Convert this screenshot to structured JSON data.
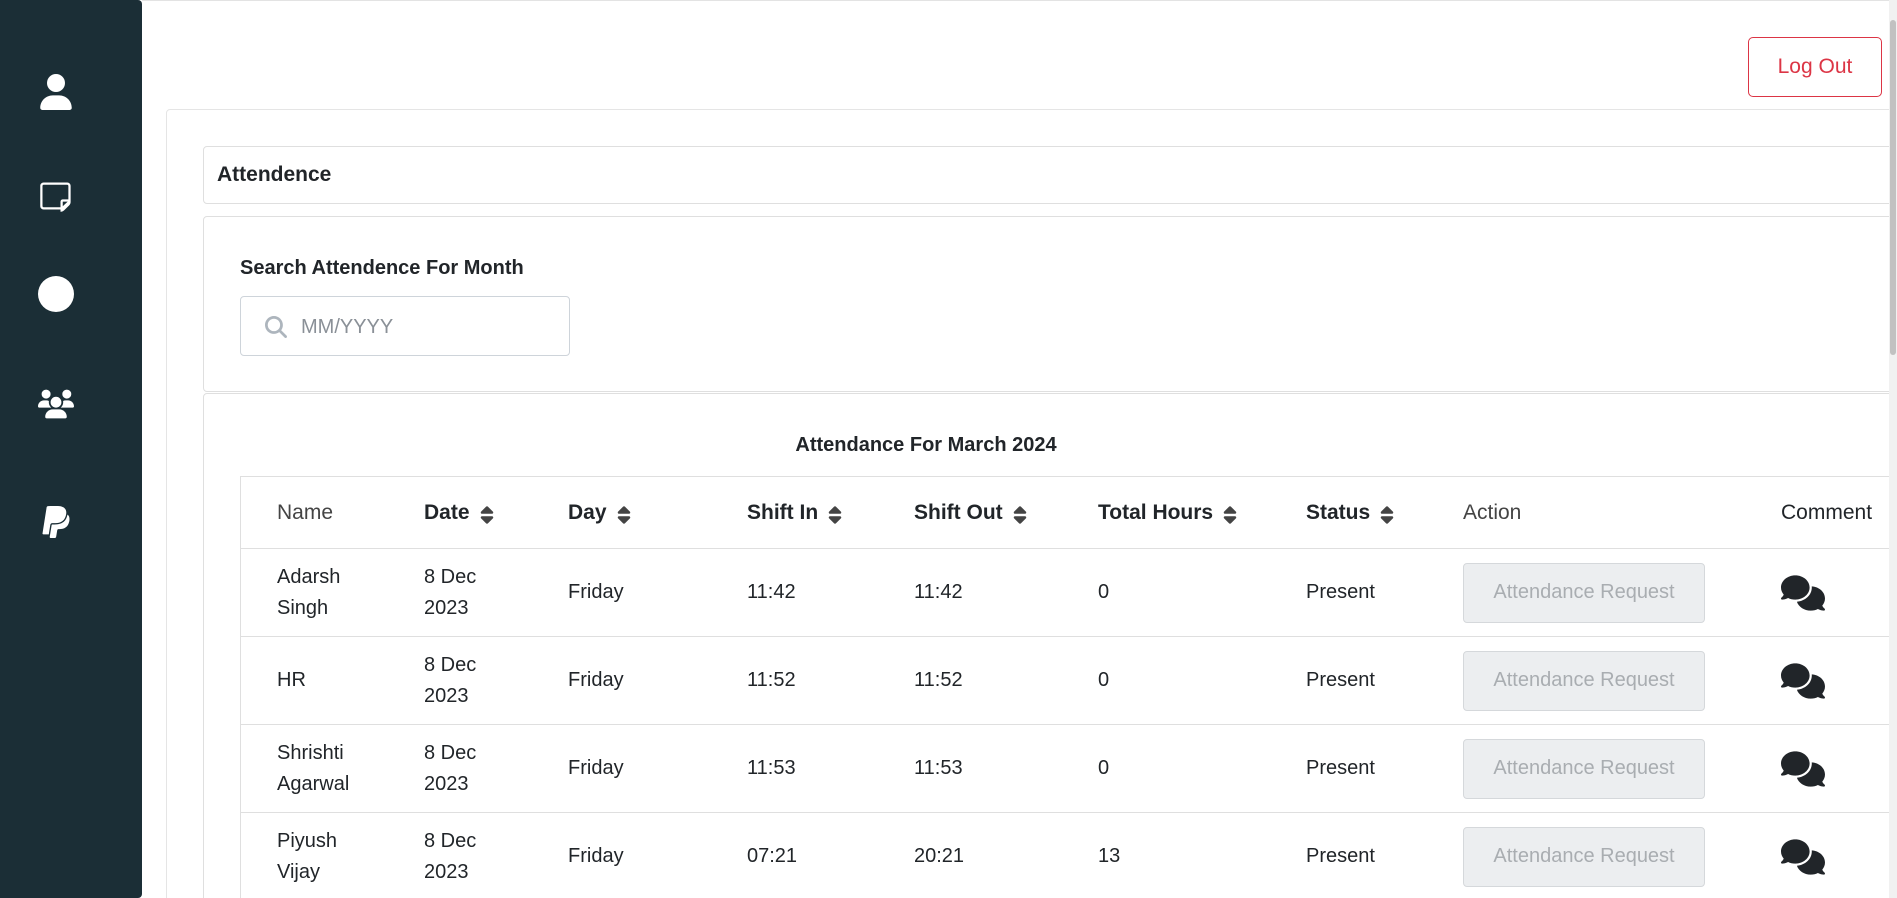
{
  "sidebar": {
    "items": [
      {
        "icon": "user-icon"
      },
      {
        "icon": "note-icon"
      },
      {
        "icon": "globe-icon"
      },
      {
        "icon": "users-icon"
      },
      {
        "icon": "paypal-icon"
      }
    ]
  },
  "header": {
    "logout_label": "Log Out"
  },
  "page_title": "Attendence",
  "search": {
    "label": "Search Attendence For Month",
    "placeholder": "MM/YYYY",
    "value": ""
  },
  "table": {
    "title": "Attendance For March 2024",
    "columns": [
      "Name",
      "Date",
      "Day",
      "Shift In",
      "Shift Out",
      "Total Hours",
      "Status",
      "Action",
      "Comment"
    ],
    "rows": [
      {
        "name_line1": "Adarsh",
        "name_line2": "Singh",
        "date_line1": "8 Dec",
        "date_line2": "2023",
        "day": "Friday",
        "shift_in": "11:42",
        "shift_out": "11:42",
        "total_hours": "0",
        "status": "Present",
        "action": "Attendance Request"
      },
      {
        "name_line1": "HR",
        "name_line2": "",
        "date_line1": "8 Dec",
        "date_line2": "2023",
        "day": "Friday",
        "shift_in": "11:52",
        "shift_out": "11:52",
        "total_hours": "0",
        "status": "Present",
        "action": "Attendance Request"
      },
      {
        "name_line1": "Shrishti",
        "name_line2": "Agarwal",
        "date_line1": "8 Dec",
        "date_line2": "2023",
        "day": "Friday",
        "shift_in": "11:53",
        "shift_out": "11:53",
        "total_hours": "0",
        "status": "Present",
        "action": "Attendance Request"
      },
      {
        "name_line1": "Piyush",
        "name_line2": "Vijay",
        "date_line1": "8 Dec",
        "date_line2": "2023",
        "day": "Friday",
        "shift_in": "07:21",
        "shift_out": "20:21",
        "total_hours": "13",
        "status": "Present",
        "action": "Attendance Request"
      }
    ]
  },
  "colors": {
    "sidebar_bg": "#1b2e36",
    "logout_red": "#dc3545",
    "disabled_button_bg": "#eceef0"
  }
}
